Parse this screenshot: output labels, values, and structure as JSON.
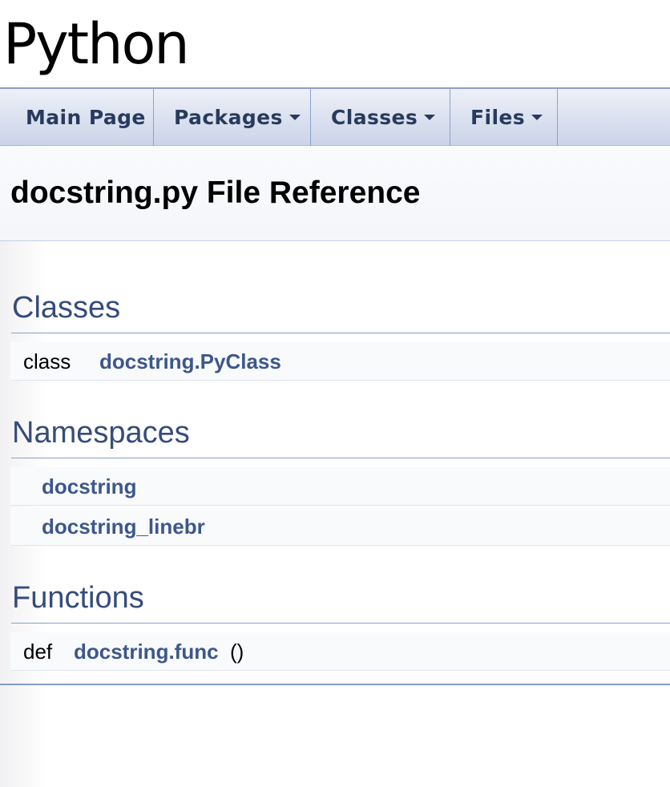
{
  "project": {
    "name": "Python"
  },
  "navbar": {
    "items": [
      {
        "label": "Main Page",
        "has_dropdown": false
      },
      {
        "label": "Packages",
        "has_dropdown": true
      },
      {
        "label": "Classes",
        "has_dropdown": true
      },
      {
        "label": "Files",
        "has_dropdown": true
      }
    ]
  },
  "header": {
    "title": "docstring.py File Reference"
  },
  "sections": {
    "classes": {
      "heading": "Classes",
      "rows": [
        {
          "left": "class",
          "link": "docstring.PyClass"
        }
      ]
    },
    "namespaces": {
      "heading": "Namespaces",
      "rows": [
        {
          "link": "docstring"
        },
        {
          "link": "docstring_linebr"
        }
      ]
    },
    "functions": {
      "heading": "Functions",
      "rows": [
        {
          "left": "def",
          "link": "docstring.func",
          "args": " ()"
        }
      ]
    }
  },
  "colors": {
    "link": "#3d578c",
    "heading": "#354c7b",
    "nav_text": "#283a5d"
  }
}
